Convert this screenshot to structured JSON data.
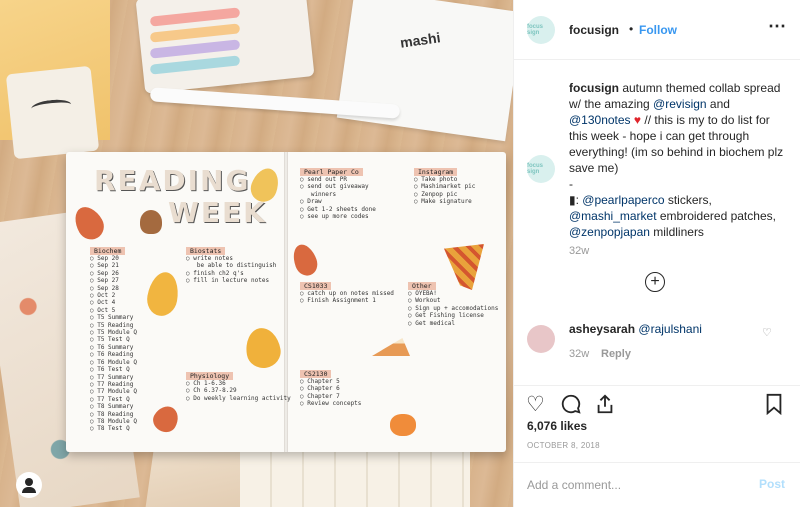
{
  "header": {
    "username": "focusign",
    "separator": "•",
    "follow_label": "Follow",
    "more_icon": "more-horizontal-icon",
    "avatar_text": "focus sign"
  },
  "caption": {
    "username": "focusign",
    "text_1": " autumn themed collab spread w/ the amazing ",
    "mention_1": "@revisign",
    "text_2": " and ",
    "mention_2": "@130notes",
    "heart": " ♥",
    "text_3": " // this is my to do list for this week - hope i can get through everything! (im so behind in biochem plz save me)",
    "dash": "-",
    "pin": "▮",
    "text_4": ": ",
    "mention_3": "@pearlpaperco",
    "text_5": " stickers, ",
    "mention_4": "@mashi_market",
    "text_6": " embroidered patches, ",
    "mention_5": "@zenpopjapan",
    "text_7": " mildliners",
    "age": "32w"
  },
  "load_more_icon": "plus-circle-icon",
  "comment": {
    "username": "asheysarah",
    "mention": "@rajulshani",
    "age": "32w",
    "reply_label": "Reply"
  },
  "actions": {
    "like_icon": "heart-outline-icon",
    "comment_icon": "comment-bubble-icon",
    "share_icon": "share-icon",
    "save_icon": "bookmark-icon"
  },
  "likes": "6,076 likes",
  "date": "OCTOBER 8, 2018",
  "add_comment": {
    "placeholder": "Add a comment...",
    "post_label": "Post"
  },
  "photo": {
    "mashi_label": "mashi",
    "title_1": "READING",
    "title_2": "WEEK",
    "sections": {
      "biochem": "Biochem",
      "biostats": "Biostats",
      "pearl": "Pearl Paper Co",
      "instagram": "Instagram",
      "cs": "CS1033",
      "other": "Other",
      "physiology": "Physiology",
      "cs2": "CS2130"
    },
    "biochem_items": "○ Sep 20\n○ Sep 21\n○ Sep 26\n○ Sep 27\n○ Sep 28\n○ Oct 2\n○ Oct 4\n○ Oct 5\n○ T5 Summary\n○ T5 Reading\n○ T5 Module Q\n○ T5 Test Q\n○ T6 Summary\n○ T6 Reading\n○ T6 Module Q\n○ T6 Test Q\n○ T7 Summary\n○ T7 Reading\n○ T7 Module Q\n○ T7 Test Q\n○ T8 Summary\n○ T8 Reading\n○ T8 Module Q\n○ T8 Test Q",
    "biostats_items": "○ write notes\n   be able to distinguish\n○ finish ch2 q's\n○ fill in lecture notes",
    "pearl_items": "○ send out PR\n○ send out giveaway\n   winners\n○ Draw\n○ Get 1-2 sheets done\n○ see up more codes",
    "instagram_items": "○ Take photo\n○ Mashimarket pic\n○ Zenpop pic\n○ Make signature",
    "cs_items": "○ catch up on notes missed\n○ Finish Assignment 1",
    "other_items": "○ OYEBA!\n○ Workout\n○ Sign up + accomodations\n○ Get Fishing license\n○ Get medical",
    "physiology_items": "○ Ch 1-6.36\n○ Ch 6.37-8.29\n○ Do weekly learning activity",
    "cs2_items": "○ Chapter 5\n○ Chapter 6\n○ Chapter 7\n○ Review concepts"
  },
  "profile_icon": "user-profile-icon"
}
